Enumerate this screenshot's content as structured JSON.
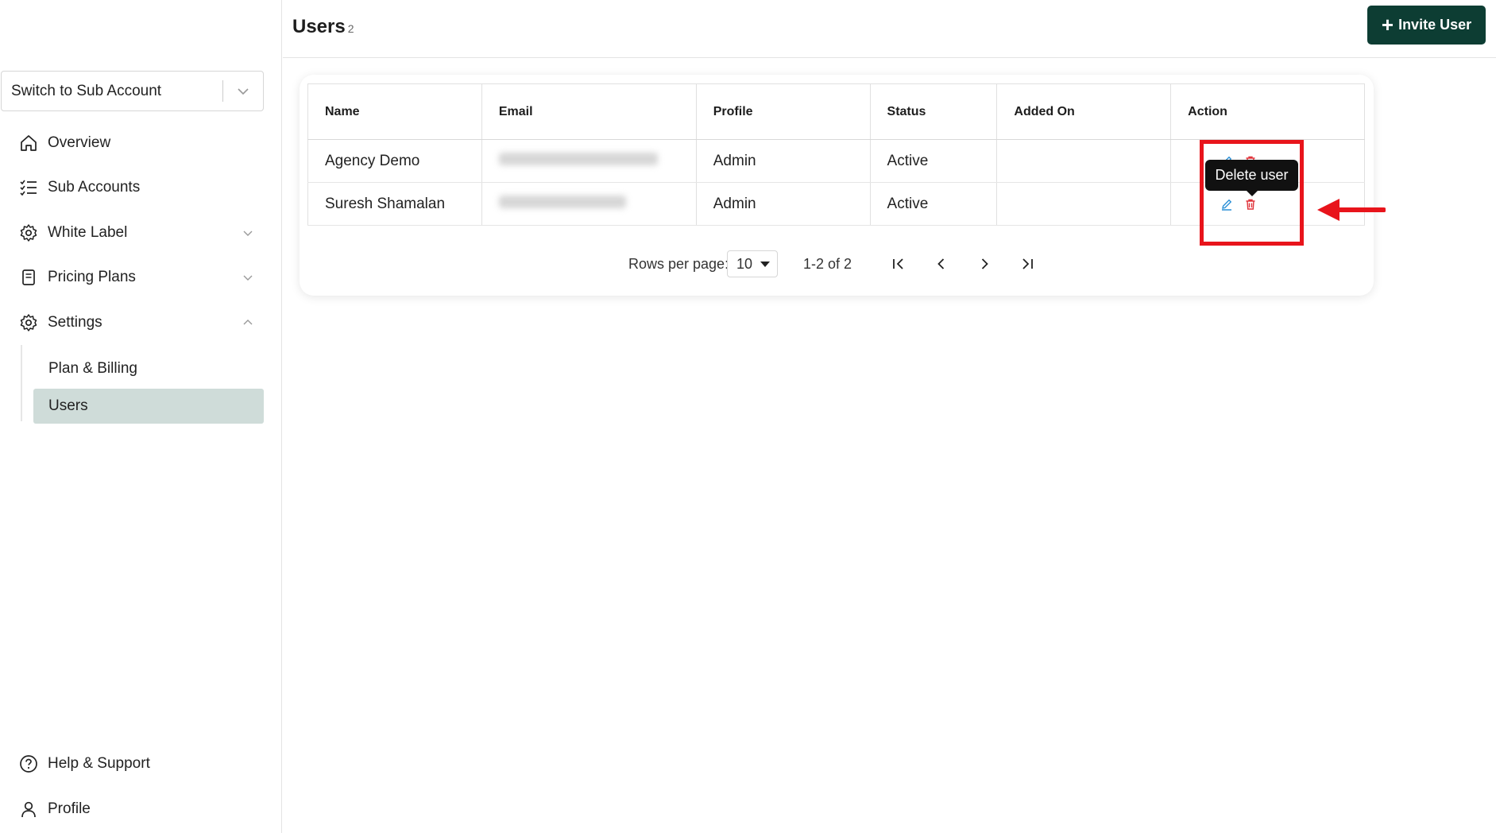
{
  "sidebar": {
    "switcher": {
      "label": "Switch to Sub Account"
    },
    "items": [
      {
        "label": "Overview",
        "icon": "home-icon"
      },
      {
        "label": "Sub Accounts",
        "icon": "checklist-icon"
      },
      {
        "label": "White Label",
        "icon": "gear-icon"
      },
      {
        "label": "Pricing Plans",
        "icon": "document-icon"
      },
      {
        "label": "Settings",
        "icon": "gear-icon"
      }
    ],
    "settings_children": [
      {
        "label": "Plan & Billing"
      },
      {
        "label": "Users",
        "active": true
      }
    ],
    "footer": [
      {
        "label": "Help & Support",
        "icon": "help-circle-icon"
      },
      {
        "label": "Profile",
        "icon": "user-icon"
      }
    ]
  },
  "header": {
    "title": "Users",
    "count": "2",
    "invite_button": "Invite User"
  },
  "table": {
    "columns": [
      "Name",
      "Email",
      "Profile",
      "Status",
      "Added On",
      "Action"
    ],
    "rows": [
      {
        "name": "Agency Demo",
        "email": "",
        "profile": "Admin",
        "status": "Active",
        "added_on": ""
      },
      {
        "name": "Suresh Shamalan",
        "email": "",
        "profile": "Admin",
        "status": "Active",
        "added_on": ""
      }
    ]
  },
  "pagination": {
    "rows_per_page_label": "Rows per page:",
    "rows_per_page_value": "10",
    "range": "1-2 of 2"
  },
  "tooltip": {
    "text": "Delete user"
  },
  "colors": {
    "primary": "#0d3d33",
    "active_nav": "#cfdcd9",
    "edit_icon": "#2a8fd6",
    "delete_icon": "#e0353c",
    "annotation": "#e8141b"
  }
}
